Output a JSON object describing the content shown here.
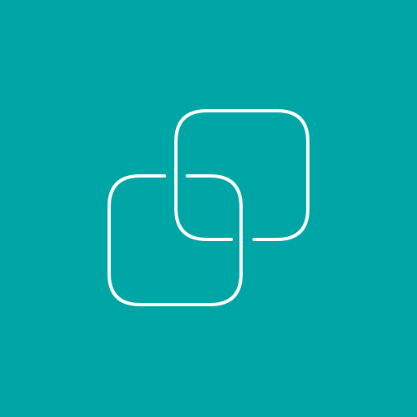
{
  "app_icon": {
    "icon_name": "interlinked-squares-icon",
    "background_color": "#00A6A6",
    "stroke_color": "#FFFFFF"
  }
}
